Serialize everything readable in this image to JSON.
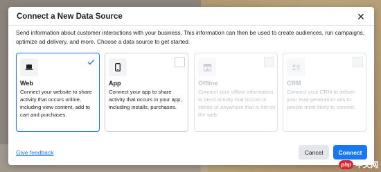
{
  "modal": {
    "title": "Connect a New Data Source",
    "description": "Send information about customer interactions with your business. This information can then be used to create audiences, run campaigns, optimize ad delivery, and more. Choose a data source to get started."
  },
  "cards": [
    {
      "title": "Web",
      "description": "Connect your website to share activity that occurs online, including view content, add to cart and purchases.",
      "icon": "laptop-icon",
      "state": "selected"
    },
    {
      "title": "App",
      "description": "Connect your app to share activity that occurs in your app, including installs, purchases.",
      "icon": "phone-icon",
      "state": "default"
    },
    {
      "title": "Offline",
      "description": "Connect your offline information to send activity that occurs in stores or anywhere that is not on the web.",
      "icon": "store-icon",
      "state": "disabled"
    },
    {
      "title": "CRM",
      "description": "Connect your CRM to deliver your lead generation ads to people most likely to convert.",
      "icon": "contact-card-icon",
      "state": "disabled"
    }
  ],
  "footer": {
    "feedback_link": "Give feedback",
    "cancel_label": "Cancel",
    "connect_label": "Connect"
  },
  "watermark": {
    "logo_text": "php",
    "site_text": "中文网"
  },
  "colors": {
    "accent": "#1877f2",
    "border": "#ccd0d5",
    "disabled_text": "#bec3c9"
  }
}
